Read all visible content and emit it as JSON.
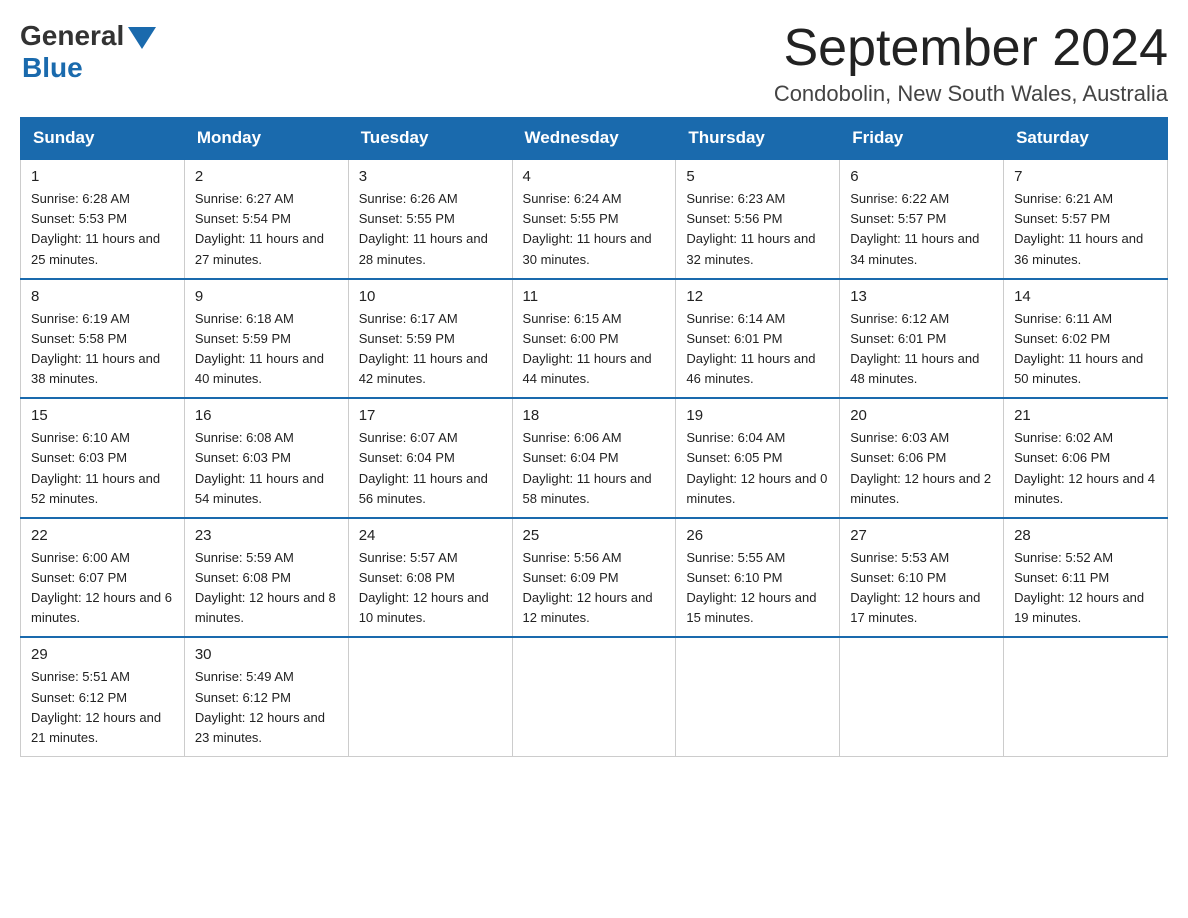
{
  "logo": {
    "general": "General",
    "blue": "Blue"
  },
  "title": "September 2024",
  "location": "Condobolin, New South Wales, Australia",
  "days_of_week": [
    "Sunday",
    "Monday",
    "Tuesday",
    "Wednesday",
    "Thursday",
    "Friday",
    "Saturday"
  ],
  "weeks": [
    [
      {
        "day": "1",
        "sunrise": "6:28 AM",
        "sunset": "5:53 PM",
        "daylight": "11 hours and 25 minutes."
      },
      {
        "day": "2",
        "sunrise": "6:27 AM",
        "sunset": "5:54 PM",
        "daylight": "11 hours and 27 minutes."
      },
      {
        "day": "3",
        "sunrise": "6:26 AM",
        "sunset": "5:55 PM",
        "daylight": "11 hours and 28 minutes."
      },
      {
        "day": "4",
        "sunrise": "6:24 AM",
        "sunset": "5:55 PM",
        "daylight": "11 hours and 30 minutes."
      },
      {
        "day": "5",
        "sunrise": "6:23 AM",
        "sunset": "5:56 PM",
        "daylight": "11 hours and 32 minutes."
      },
      {
        "day": "6",
        "sunrise": "6:22 AM",
        "sunset": "5:57 PM",
        "daylight": "11 hours and 34 minutes."
      },
      {
        "day": "7",
        "sunrise": "6:21 AM",
        "sunset": "5:57 PM",
        "daylight": "11 hours and 36 minutes."
      }
    ],
    [
      {
        "day": "8",
        "sunrise": "6:19 AM",
        "sunset": "5:58 PM",
        "daylight": "11 hours and 38 minutes."
      },
      {
        "day": "9",
        "sunrise": "6:18 AM",
        "sunset": "5:59 PM",
        "daylight": "11 hours and 40 minutes."
      },
      {
        "day": "10",
        "sunrise": "6:17 AM",
        "sunset": "5:59 PM",
        "daylight": "11 hours and 42 minutes."
      },
      {
        "day": "11",
        "sunrise": "6:15 AM",
        "sunset": "6:00 PM",
        "daylight": "11 hours and 44 minutes."
      },
      {
        "day": "12",
        "sunrise": "6:14 AM",
        "sunset": "6:01 PM",
        "daylight": "11 hours and 46 minutes."
      },
      {
        "day": "13",
        "sunrise": "6:12 AM",
        "sunset": "6:01 PM",
        "daylight": "11 hours and 48 minutes."
      },
      {
        "day": "14",
        "sunrise": "6:11 AM",
        "sunset": "6:02 PM",
        "daylight": "11 hours and 50 minutes."
      }
    ],
    [
      {
        "day": "15",
        "sunrise": "6:10 AM",
        "sunset": "6:03 PM",
        "daylight": "11 hours and 52 minutes."
      },
      {
        "day": "16",
        "sunrise": "6:08 AM",
        "sunset": "6:03 PM",
        "daylight": "11 hours and 54 minutes."
      },
      {
        "day": "17",
        "sunrise": "6:07 AM",
        "sunset": "6:04 PM",
        "daylight": "11 hours and 56 minutes."
      },
      {
        "day": "18",
        "sunrise": "6:06 AM",
        "sunset": "6:04 PM",
        "daylight": "11 hours and 58 minutes."
      },
      {
        "day": "19",
        "sunrise": "6:04 AM",
        "sunset": "6:05 PM",
        "daylight": "12 hours and 0 minutes."
      },
      {
        "day": "20",
        "sunrise": "6:03 AM",
        "sunset": "6:06 PM",
        "daylight": "12 hours and 2 minutes."
      },
      {
        "day": "21",
        "sunrise": "6:02 AM",
        "sunset": "6:06 PM",
        "daylight": "12 hours and 4 minutes."
      }
    ],
    [
      {
        "day": "22",
        "sunrise": "6:00 AM",
        "sunset": "6:07 PM",
        "daylight": "12 hours and 6 minutes."
      },
      {
        "day": "23",
        "sunrise": "5:59 AM",
        "sunset": "6:08 PM",
        "daylight": "12 hours and 8 minutes."
      },
      {
        "day": "24",
        "sunrise": "5:57 AM",
        "sunset": "6:08 PM",
        "daylight": "12 hours and 10 minutes."
      },
      {
        "day": "25",
        "sunrise": "5:56 AM",
        "sunset": "6:09 PM",
        "daylight": "12 hours and 12 minutes."
      },
      {
        "day": "26",
        "sunrise": "5:55 AM",
        "sunset": "6:10 PM",
        "daylight": "12 hours and 15 minutes."
      },
      {
        "day": "27",
        "sunrise": "5:53 AM",
        "sunset": "6:10 PM",
        "daylight": "12 hours and 17 minutes."
      },
      {
        "day": "28",
        "sunrise": "5:52 AM",
        "sunset": "6:11 PM",
        "daylight": "12 hours and 19 minutes."
      }
    ],
    [
      {
        "day": "29",
        "sunrise": "5:51 AM",
        "sunset": "6:12 PM",
        "daylight": "12 hours and 21 minutes."
      },
      {
        "day": "30",
        "sunrise": "5:49 AM",
        "sunset": "6:12 PM",
        "daylight": "12 hours and 23 minutes."
      },
      null,
      null,
      null,
      null,
      null
    ]
  ],
  "labels": {
    "sunrise": "Sunrise:",
    "sunset": "Sunset:",
    "daylight": "Daylight:"
  }
}
